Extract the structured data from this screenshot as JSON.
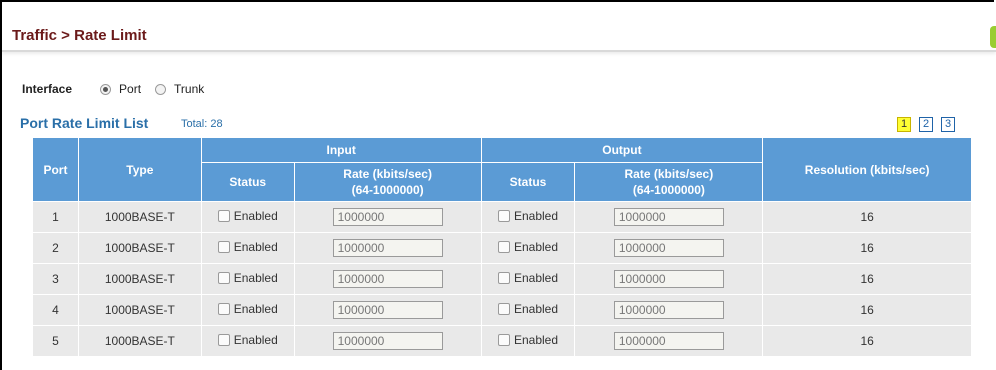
{
  "breadcrumb": "Traffic > Rate Limit",
  "interface": {
    "label": "Interface",
    "options": [
      "Port",
      "Trunk"
    ],
    "selected": "Port"
  },
  "list": {
    "title": "Port Rate Limit List",
    "total": "Total: 28",
    "pages": [
      "1",
      "2",
      "3"
    ],
    "current_page": "1"
  },
  "table": {
    "headers": {
      "port": "Port",
      "type": "Type",
      "input": "Input",
      "output": "Output",
      "status": "Status",
      "rate": "Rate (kbits/sec)",
      "rate_range": "(64-1000000)",
      "resolution": "Resolution (kbits/sec)"
    },
    "checkbox_label": "Enabled",
    "rows": [
      {
        "port": "1",
        "type": "1000BASE-T",
        "input_rate": "1000000",
        "output_rate": "1000000",
        "resolution": "16"
      },
      {
        "port": "2",
        "type": "1000BASE-T",
        "input_rate": "1000000",
        "output_rate": "1000000",
        "resolution": "16"
      },
      {
        "port": "3",
        "type": "1000BASE-T",
        "input_rate": "1000000",
        "output_rate": "1000000",
        "resolution": "16"
      },
      {
        "port": "4",
        "type": "1000BASE-T",
        "input_rate": "1000000",
        "output_rate": "1000000",
        "resolution": "16"
      },
      {
        "port": "5",
        "type": "1000BASE-T",
        "input_rate": "1000000",
        "output_rate": "1000000",
        "resolution": "16"
      }
    ]
  },
  "colors": {
    "header_bg": "#5b9bd5",
    "row_bg": "#e9e9e9",
    "title": "#6b1a1a",
    "list_title": "#2a6fa8",
    "current_page_bg": "#ffff33"
  }
}
